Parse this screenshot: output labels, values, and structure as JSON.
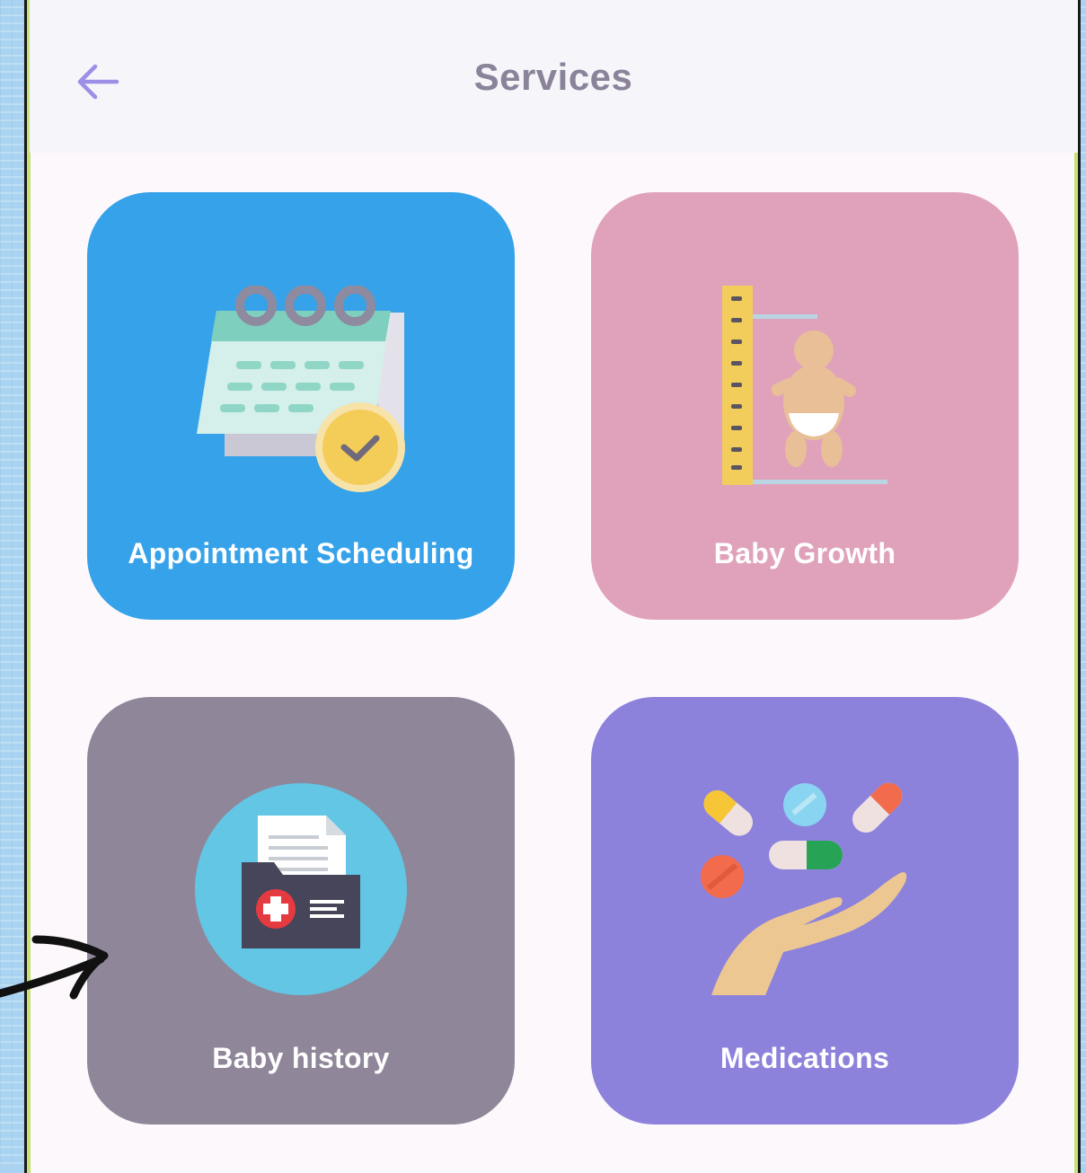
{
  "header": {
    "title": "Services",
    "back_icon": "arrow-left-icon"
  },
  "services": [
    {
      "label": "Appointment Scheduling",
      "icon": "calendar-clock-icon",
      "color": "#36a2e9"
    },
    {
      "label": "Baby Growth",
      "icon": "baby-height-ruler-icon",
      "color": "#e0a2bb"
    },
    {
      "label": "Baby history",
      "icon": "medical-folder-icon",
      "color": "#90869a"
    },
    {
      "label": "Medications",
      "icon": "pills-hand-icon",
      "color": "#8c82dc"
    }
  ],
  "colors": {
    "accent": "#9b8fe6",
    "title": "#8a8399",
    "appbar": "#f6f5fa",
    "screen": "#fdf8fc"
  }
}
